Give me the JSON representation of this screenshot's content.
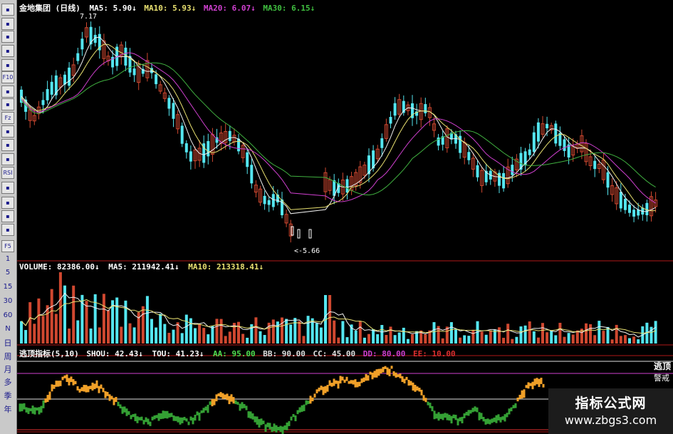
{
  "toolbar": {
    "icons": [
      "chart-icon",
      "bar-icon",
      "line-icon",
      "candle-icon",
      "cross-icon",
      "f10-icon",
      "note-icon",
      "ma-icon",
      "fz-icon",
      "ratio-icon",
      "clock-icon",
      "wave-icon",
      "rsi-icon",
      "money-icon",
      "move-icon",
      "export-icon",
      "pencil-icon",
      "f5-icon"
    ],
    "labels": [
      "",
      "",
      "",
      "",
      "",
      "F10",
      "",
      "",
      "Fz",
      "",
      "",
      "",
      "RSI",
      "",
      "",
      "",
      "",
      "F5"
    ],
    "periods": [
      "1",
      "5",
      "15",
      "30",
      "60",
      "N"
    ],
    "periods_cn": [
      "日",
      "周",
      "月",
      "多",
      "季",
      "年"
    ]
  },
  "price_header": {
    "stock": "金地集团 (日线)",
    "ma5_label": "MA5:",
    "ma5_value": "5.90↓",
    "ma10_label": "MA10:",
    "ma10_value": "5.93↓",
    "ma20_label": "MA20:",
    "ma20_value": "6.07↓",
    "ma30_label": "MA30:",
    "ma30_value": "6.15↓"
  },
  "price_annotations": {
    "high": "7.17",
    "low": "<-5.66"
  },
  "volume_header": {
    "label": "VOLUME:",
    "value": "82386.00↓",
    "ma5_label": "MA5:",
    "ma5_value": "211942.41↓",
    "ma10_label": "MA10:",
    "ma10_value": "213318.41↓"
  },
  "indicator_header": {
    "name": "逃顶指标(5,10)",
    "shou_label": "SHOU:",
    "shou_value": "42.43↓",
    "tou_label": "TOU:",
    "tou_value": "41.23↓",
    "aa_label": "AA:",
    "aa_value": "95.00",
    "bb_label": "BB:",
    "bb_value": "90.00",
    "cc_label": "CC:",
    "cc_value": "45.00",
    "dd_label": "DD:",
    "dd_value": "80.00",
    "ee_label": "EE:",
    "ee_value": "10.00"
  },
  "right_labels": {
    "top": "逃顶",
    "bottom": "警戒"
  },
  "watermark": {
    "title": "指标公式网",
    "url": "www.zbgs3.com"
  },
  "colors": {
    "up": "#d04830",
    "down": "#54e6f0",
    "ma5": "#f0f0f0",
    "ma10": "#e8e070",
    "ma20": "#d040d0",
    "ma30": "#40b040",
    "shou": "#f0a028",
    "tou": "#34a034",
    "grid": "#b01818"
  }
}
